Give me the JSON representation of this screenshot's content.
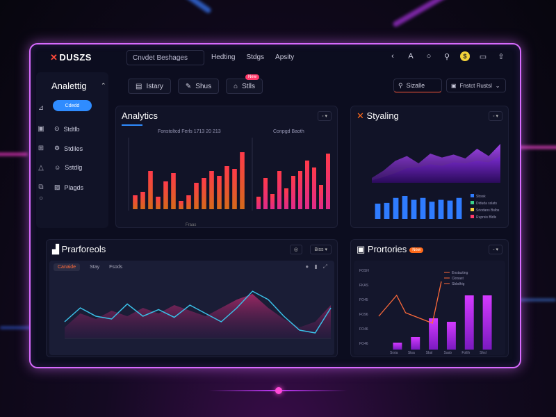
{
  "app": {
    "logo": "DUSZS",
    "breadcrumb": "Cnvdet Beshages"
  },
  "topnav": [
    "Hedting",
    "Stdgs",
    "Apsity"
  ],
  "top_icons": [
    "back-icon",
    "text-size-icon",
    "search-icon",
    "key-icon",
    "coin-icon",
    "clipboard-icon",
    "share-icon"
  ],
  "sidebar": {
    "title": "Analettig",
    "pill": "Cdedd",
    "items": [
      {
        "icon": "calendar-icon",
        "label": "Stdtlb"
      },
      {
        "icon": "gear-icon",
        "label": "Stdiles"
      },
      {
        "icon": "user-icon",
        "label": "Sstdlg"
      },
      {
        "icon": "image-icon",
        "label": "Plagds"
      }
    ]
  },
  "tabs": [
    {
      "label": "Istary",
      "icon": "doc-icon"
    },
    {
      "label": "Shus",
      "icon": "pen-icon"
    },
    {
      "label": "Stlls",
      "icon": "bag-icon",
      "badge": "New"
    }
  ],
  "search": {
    "label": "Sizalle"
  },
  "select": {
    "label": "Fnstct Rustsl"
  },
  "panels": {
    "analytics": {
      "title": "Analytics",
      "btn": "◦ ▾",
      "sub1": "Fonstoltcd Ferls 1713 20 213",
      "sub2": "Conpgd Baoth",
      "xlabel": "Fraas"
    },
    "styling": {
      "title": "Styaling",
      "btn": "◦ ▾"
    },
    "performance": {
      "title": "Prarforeols",
      "btn": "Biss ▾",
      "tabs": [
        "Canaide",
        "Stay",
        "Fsods"
      ]
    },
    "proportions": {
      "title": "Prortories",
      "tag": "New",
      "btn": "◦ ▾",
      "legend": [
        "Enstacting",
        "Ckrsast",
        "Sbbdhig"
      ],
      "ylabels": [
        "FOSH",
        "FKAS",
        "FO45",
        "FO96",
        "FO46",
        "FO46"
      ],
      "xlabels": [
        "Srsia",
        "Stsa",
        "Sbsl",
        "Sasb",
        "FoEh",
        "Shsl"
      ]
    }
  },
  "chart_data": [
    {
      "type": "bar",
      "title": "Fonstoltcd Ferls 1713 20 213",
      "xlabel": "Fraas",
      "values": [
        20,
        25,
        55,
        18,
        40,
        52,
        12,
        20,
        38,
        45,
        55,
        48,
        62,
        58,
        82
      ]
    },
    {
      "type": "bar",
      "title": "Conpgd Baoth",
      "values": [
        18,
        45,
        22,
        55,
        30,
        48,
        55,
        70,
        60,
        35,
        80
      ]
    },
    {
      "type": "area",
      "title": "Styaling",
      "series": [
        {
          "values": [
            10,
            25,
            45,
            55,
            40,
            60,
            52,
            58,
            50,
            70,
            55,
            80
          ]
        },
        {
          "values": [
            5,
            12,
            20,
            30,
            32,
            38,
            35,
            42,
            40,
            45,
            42,
            55
          ]
        }
      ]
    },
    {
      "type": "bar",
      "title": "Styaling",
      "values": [
        40,
        42,
        55,
        60,
        50,
        55,
        45,
        50,
        48,
        55
      ],
      "legend": [
        "Sbssk",
        "Diduda sslats",
        "Sriodans Bslbs",
        "Ruprsis Bldls"
      ]
    },
    {
      "type": "area",
      "title": "Prarforeols",
      "series": [
        {
          "name": "cyan",
          "values": [
            30,
            55,
            40,
            35,
            62,
            40,
            52,
            38,
            60,
            45,
            30,
            55,
            85,
            70,
            40,
            15,
            10,
            55
          ]
        },
        {
          "name": "magenta",
          "values": [
            20,
            45,
            35,
            50,
            40,
            55,
            45,
            60,
            50,
            40,
            55,
            70,
            80,
            55,
            35,
            20,
            30,
            60
          ]
        }
      ]
    },
    {
      "type": "bar",
      "title": "Prortories",
      "values": [
        10,
        18,
        45,
        40,
        78,
        78
      ],
      "line": [
        40,
        55,
        70,
        45,
        40,
        35,
        30,
        90
      ]
    }
  ]
}
